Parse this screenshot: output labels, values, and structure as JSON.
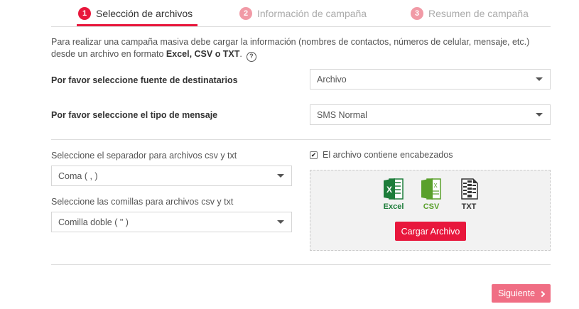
{
  "stepper": {
    "steps": [
      {
        "number": "1",
        "label": "Selección de archivos",
        "active": true
      },
      {
        "number": "2",
        "label": "Información de campaña",
        "active": false
      },
      {
        "number": "3",
        "label": "Resumen de campaña",
        "active": false
      }
    ]
  },
  "intro": {
    "text": "Para realizar una campaña masiva debe cargar la información (nombres de contactos, números de celular, mensaje, etc.) desde un archivo en formato ",
    "formats": "Excel, CSV o TXT",
    "suffix": ".",
    "help_icon": "question-circle-icon"
  },
  "source_field": {
    "label": "Por favor seleccione fuente de destinatarios",
    "value": "Archivo"
  },
  "message_type_field": {
    "label": "Por favor seleccione el tipo de mensaje",
    "value": "SMS Normal"
  },
  "separator_field": {
    "label": "Seleccione el separador para archivos csv y txt",
    "value": "Coma ( , )"
  },
  "quotes_field": {
    "label": "Seleccione las comillas para archivos csv y txt",
    "value": "Comilla doble ( \" )"
  },
  "headers_checkbox": {
    "label": "El archivo contiene encabezados",
    "checked": true
  },
  "dropzone": {
    "file_types": [
      {
        "label": "Excel",
        "icon": "excel-file-icon",
        "color": "#1d7d3a"
      },
      {
        "label": "CSV",
        "icon": "csv-file-icon",
        "color": "#5aa02c"
      },
      {
        "label": "TXT",
        "icon": "txt-file-icon",
        "color": "#333333"
      }
    ],
    "upload_label": "Cargar Archivo"
  },
  "footer": {
    "next_label": "Siguiente"
  },
  "colors": {
    "accent": "#e8173c",
    "accent_light": "#f06e84"
  }
}
